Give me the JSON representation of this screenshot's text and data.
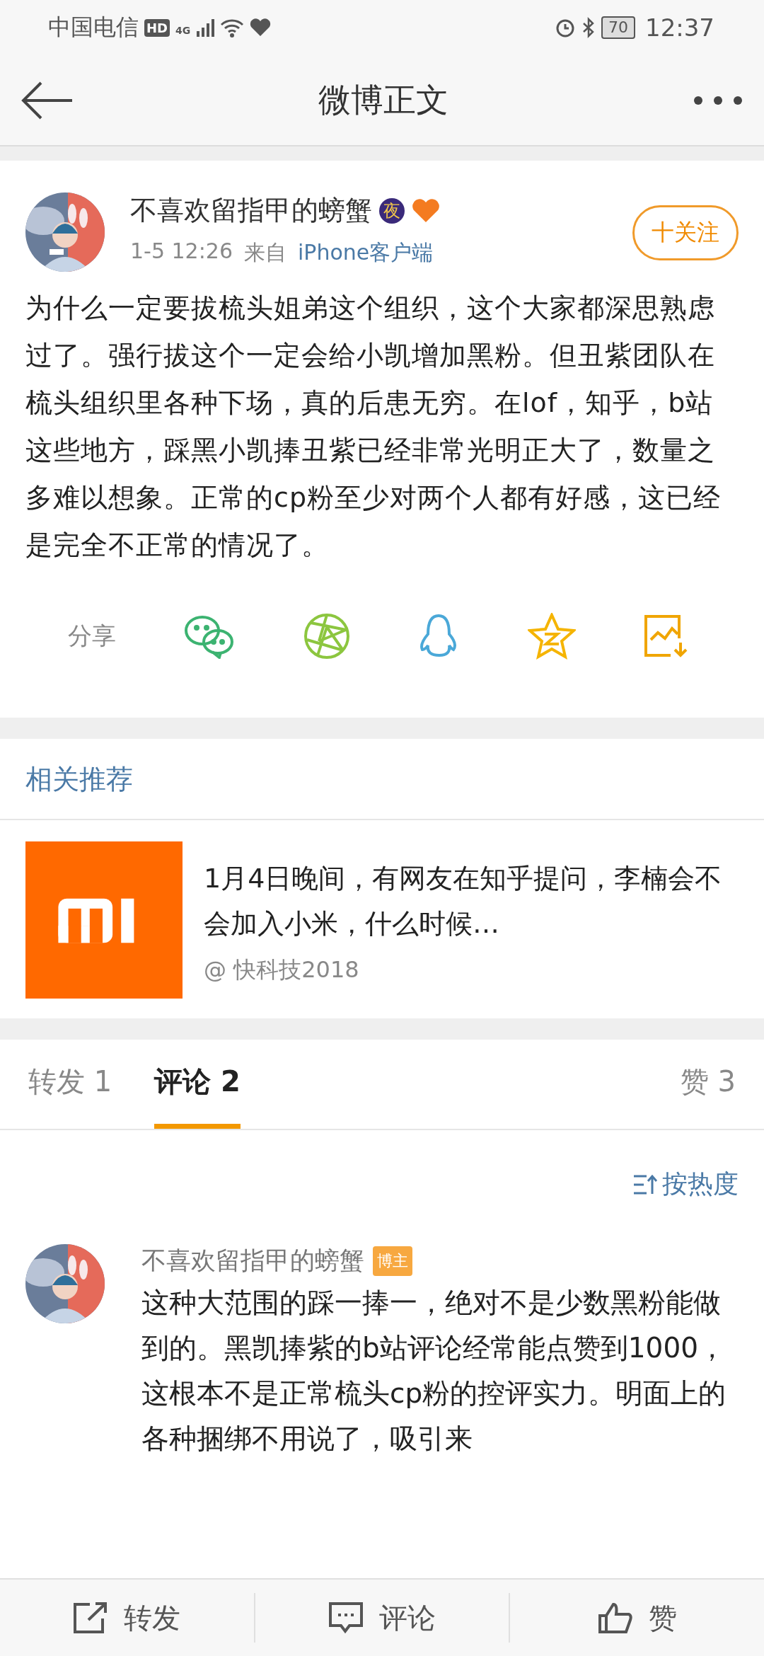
{
  "status_bar": {
    "carrier": "中国电信",
    "hd_badge": "HD",
    "network": "4G",
    "battery": "70",
    "time": "12:37"
  },
  "header": {
    "title": "微博正文"
  },
  "post": {
    "author": "不喜欢留指甲的螃蟹",
    "night_badge": "夜",
    "follow_button": "十关注",
    "date": "1-5 12:26",
    "source_prefix": "来自",
    "source": "iPhone客户端",
    "text": "为什么一定要拔梳头姐弟这个组织，这个大家都深思熟虑过了。强行拔这个一定会给小凯增加黑粉。但丑紫团队在梳头组织里各种下场，真的后患无穷。在lof，知乎，b站这些地方，踩黑小凯捧丑紫已经非常光明正大了，数量之多难以想象。正常的cp粉至少对两个人都有好感，这已经是完全不正常的情况了。",
    "share_label": "分享",
    "share_targets": [
      {
        "kind": "wechat",
        "color": "#3cb371"
      },
      {
        "kind": "moments",
        "color": "#8cc63f"
      },
      {
        "kind": "qq",
        "color": "#4aa8d8"
      },
      {
        "kind": "qzone",
        "color": "#f5b400"
      },
      {
        "kind": "save_image",
        "color": "#f0a500"
      }
    ]
  },
  "related": {
    "heading": "相关推荐",
    "items": [
      {
        "title": "1月4日晚间，有网友在知乎提问，李楠会不会加入小米，什么时候…",
        "source": "@ 快科技2018"
      }
    ]
  },
  "tabs": [
    {
      "label": "转发 1",
      "selected": false
    },
    {
      "label": "评论 2",
      "selected": true
    },
    {
      "label": "赞 3",
      "selected": false
    }
  ],
  "sort_button": "按热度",
  "comments": [
    {
      "author": "不喜欢留指甲的螃蟹",
      "badge": "博主",
      "text": "这种大范围的踩一捧一，绝对不是少数黑粉能做到的。黑凯捧紫的b站评论经常能点赞到1000，这根本不是正常梳头cp粉的控评实力。明面上的各种捆绑不用说了，吸引来"
    }
  ],
  "bottom_bar": [
    {
      "kind": "repost",
      "label": "转发"
    },
    {
      "kind": "comment",
      "label": "评论"
    },
    {
      "kind": "like",
      "label": "赞"
    }
  ]
}
